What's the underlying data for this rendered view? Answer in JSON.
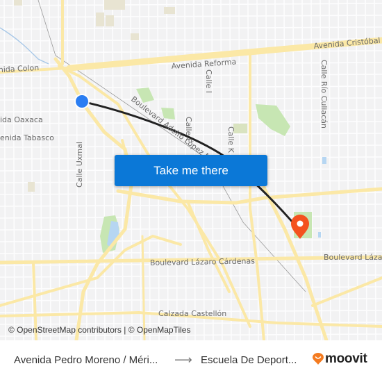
{
  "map": {
    "street_labels": [
      {
        "id": "avenida-cristobal",
        "text": "Avenida Cristóbal C"
      },
      {
        "id": "avenida-reforma",
        "text": "Avenida Reforma"
      },
      {
        "id": "avenida-colon",
        "text": "nida Colon"
      },
      {
        "id": "avenida-oaxaca",
        "text": "ida Oaxaca"
      },
      {
        "id": "avenida-tabasco",
        "text": "enida Tabasco"
      },
      {
        "id": "calle-uxmal",
        "text": "Calle Uxmal"
      },
      {
        "id": "calle-i",
        "text": "Calle I"
      },
      {
        "id": "calle-f",
        "text": "Calle F"
      },
      {
        "id": "calle-k",
        "text": "Calle K"
      },
      {
        "id": "calle-rio-culiacan",
        "text": "Calle Río Culiacán"
      },
      {
        "id": "boulevard-adolfo-lopez",
        "text": "Boulevard Adolfo López Mateos"
      },
      {
        "id": "boulevard-lazaro-cardenas",
        "text": "Boulevard Lázaro Cárdenas"
      },
      {
        "id": "boulevard-lazaro-east",
        "text": "Boulevard Lázar"
      },
      {
        "id": "calzada-castellon",
        "text": "Calzada Castellón"
      }
    ],
    "colors": {
      "background": "#f2f2f3",
      "major_road": "#fbe8a6",
      "minor_road": "#ffffff",
      "park": "#c7e6b3",
      "water": "#b6d6f2",
      "route": "#222222",
      "origin_marker": "#2a7df2",
      "destination_marker": "#f4511e"
    }
  },
  "cta": {
    "label": "Take me there",
    "color": "#0b78d7"
  },
  "attribution": "© OpenStreetMap contributors | © OpenMapTiles",
  "footer": {
    "origin": "Avenida Pedro Moreno / Méri...",
    "arrow": "⟶",
    "destination": "Escuela De Deport...",
    "brand": "moovit",
    "brand_color": "#f47b20"
  }
}
